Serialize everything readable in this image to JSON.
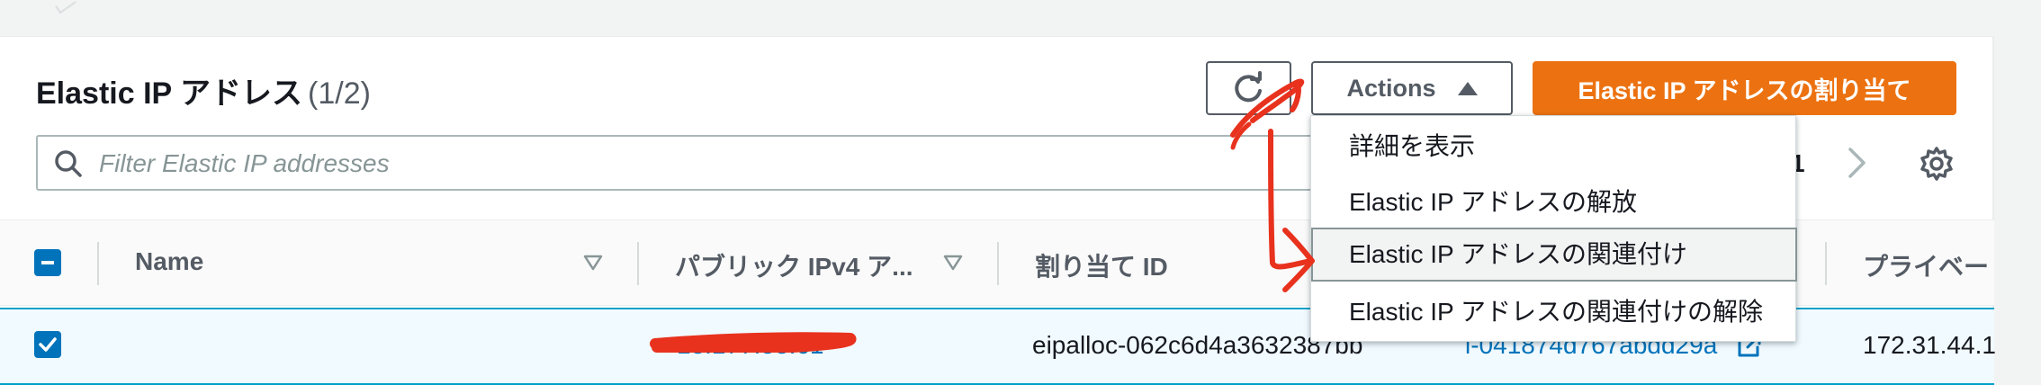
{
  "header": {
    "title": "Elastic IP アドレス",
    "count": "(1/2)"
  },
  "toolbar": {
    "actions_label": "Actions",
    "allocate_label": "Elastic IP アドレスの割り当て"
  },
  "search": {
    "placeholder": "Filter Elastic IP addresses",
    "value": ""
  },
  "pagination": {
    "current_page": "1"
  },
  "actions_menu": {
    "items": [
      {
        "label": "詳細を表示"
      },
      {
        "label": "Elastic IP アドレスの解放"
      },
      {
        "label": "Elastic IP アドレスの関連付け",
        "highlighted": true
      },
      {
        "label": "Elastic IP アドレスの関連付けの解除"
      }
    ]
  },
  "table": {
    "columns": [
      {
        "label": "Name"
      },
      {
        "label": "パブリック IPv4 ア..."
      },
      {
        "label": "割り当て ID"
      },
      {
        "label": "プライベー"
      }
    ],
    "rows": [
      {
        "selected": true,
        "name": "",
        "public_ip": "18.177.58.61",
        "allocation_id": "eipalloc-062c6d4a3632387bb",
        "instance_id": "i-041874d767abdd29a",
        "private_ip": "172.31.44.1"
      }
    ]
  },
  "icons": {
    "refresh": "refresh-icon",
    "search": "search-icon",
    "next": "chevron-right-icon",
    "settings": "gear-icon",
    "sort": "sort-down-icon",
    "external_link": "external-link-icon"
  },
  "colors": {
    "primary_orange": "#ec7211",
    "link_blue": "#0073bb",
    "selection_border": "#00a1c9",
    "annotation_red": "#e8321e"
  }
}
